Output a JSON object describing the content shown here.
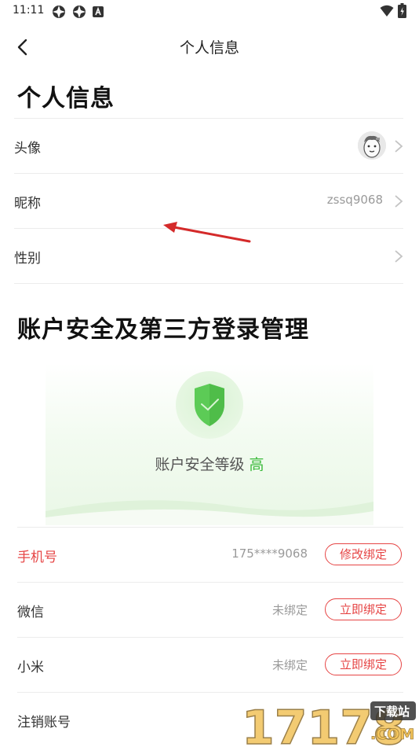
{
  "status_bar": {
    "time": "11:11",
    "icons": [
      "notification-icon",
      "notification-icon",
      "letter-a-icon",
      "wifi-icon",
      "battery-icon"
    ]
  },
  "nav": {
    "title": "个人信息",
    "back_icon": "chevron-left-icon"
  },
  "profile": {
    "heading": "个人信息",
    "rows": [
      {
        "label": "头像",
        "value": "",
        "icon": "avatar"
      },
      {
        "label": "昵称",
        "value": "zssq9068"
      },
      {
        "label": "性别",
        "value": ""
      }
    ]
  },
  "security": {
    "heading": "账户安全及第三方登录管理",
    "level_label": "账户安全等级",
    "level_value": "高",
    "accent_color": "#3cba3c"
  },
  "accounts": [
    {
      "label": "手机号",
      "value": "175****9068",
      "button": "修改绑定",
      "highlight": true
    },
    {
      "label": "微信",
      "value": "未绑定",
      "button": "立即绑定",
      "highlight": false
    },
    {
      "label": "小米",
      "value": "未绑定",
      "button": "立即绑定",
      "highlight": false
    },
    {
      "label": "注销账号",
      "value": "",
      "button": "",
      "highlight": false
    }
  ],
  "watermark": {
    "number": "17178",
    "badge": "下载站",
    "suffix": ".COM"
  },
  "colors": {
    "brand_red": "#e64545",
    "secure_green": "#3cba3c"
  }
}
